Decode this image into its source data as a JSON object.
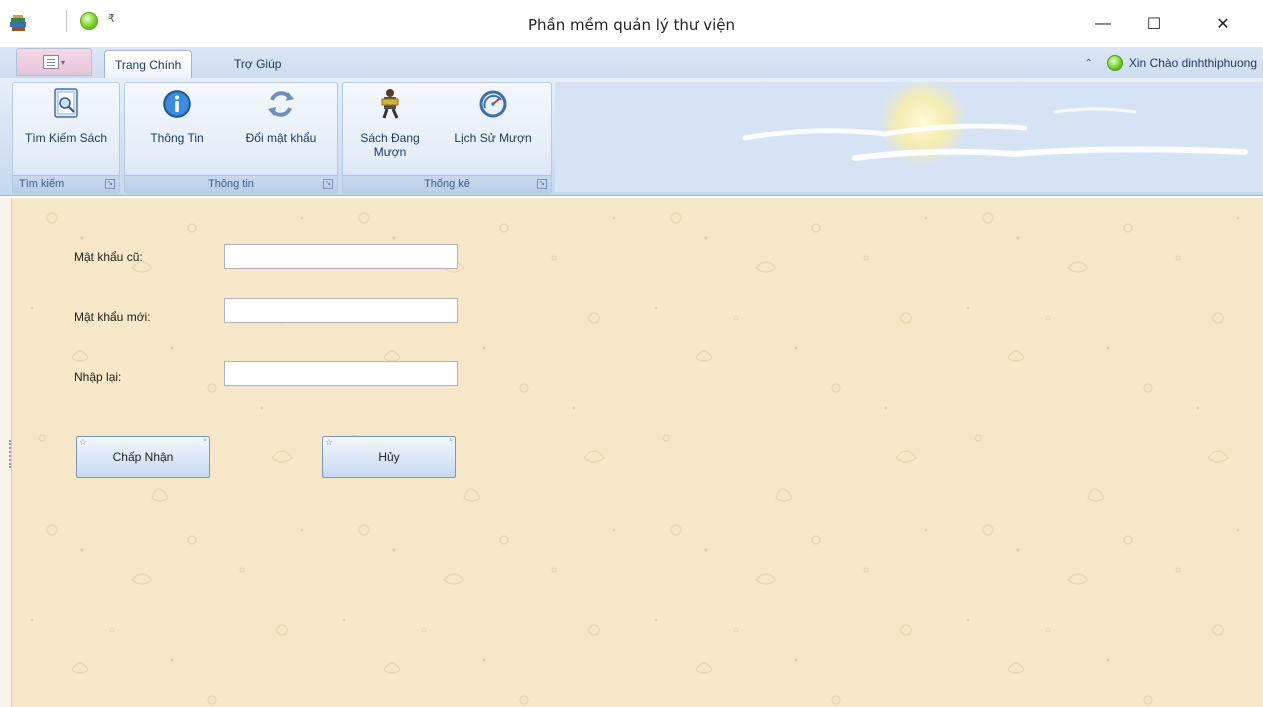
{
  "window": {
    "title": "Phần mềm quản lý thư viện",
    "minimize_glyph": "—",
    "maximize_glyph": "☐",
    "close_glyph": "✕"
  },
  "quick_access": {
    "dropdown_glyph": "₹"
  },
  "tabs": [
    {
      "label": "Trang Chính",
      "active": true
    },
    {
      "label": "Trợ Giúp",
      "active": false
    }
  ],
  "greeting": {
    "text": "Xin Chào dinhthiphuong",
    "collapse_glyph": "⌃"
  },
  "ribbon": {
    "groups": [
      {
        "title": "Tìm kiếm",
        "buttons": [
          {
            "label": "Tìm Kiếm Sách",
            "icon": "book-search-icon"
          }
        ]
      },
      {
        "title": "Thông tin",
        "buttons": [
          {
            "label": "Thông Tin",
            "icon": "info-icon"
          },
          {
            "label": "Đổi mật khẩu",
            "icon": "refresh-icon"
          }
        ]
      },
      {
        "title": "Thống kê",
        "buttons": [
          {
            "label": "Sách Đang Mượn",
            "icon": "reader-icon"
          },
          {
            "label": "Lịch Sử Mượn",
            "icon": "history-icon"
          }
        ]
      }
    ],
    "launcher_glyph": "↘"
  },
  "form": {
    "old_password_label": "Mật khẩu cũ:",
    "old_password_value": "",
    "new_password_label": "Mật khẩu mới:",
    "new_password_value": "",
    "confirm_label": "Nhập lại:",
    "confirm_value": "",
    "accept_label": "Chấp Nhận",
    "cancel_label": "Hủy"
  },
  "colors": {
    "content_bg": "#f5e7c8",
    "ribbon_bg": "#d4e1f3",
    "accent": "#1e395b"
  }
}
